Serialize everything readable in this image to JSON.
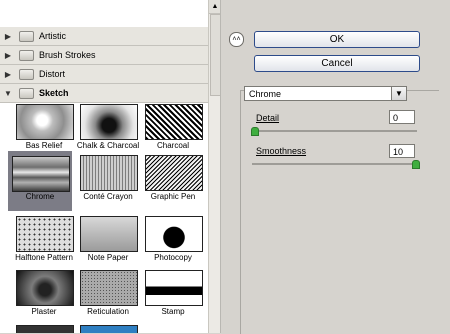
{
  "categories": [
    {
      "label": "Artistic",
      "open": false
    },
    {
      "label": "Brush Strokes",
      "open": false
    },
    {
      "label": "Distort",
      "open": false
    },
    {
      "label": "Sketch",
      "open": true
    }
  ],
  "icons": {
    "collapsed": "triangle-right",
    "expanded": "triangle-down",
    "folder": "folder-icon",
    "scroll_up": "arrow-up-icon",
    "collapse_btn": "double-chevron-up-icon"
  },
  "filters": [
    {
      "label": "Bas Relief",
      "selected": false
    },
    {
      "label": "Chalk & Charcoal",
      "selected": false
    },
    {
      "label": "Charcoal",
      "selected": false
    },
    {
      "label": "Chrome",
      "selected": true
    },
    {
      "label": "Conté Crayon",
      "selected": false
    },
    {
      "label": "Graphic Pen",
      "selected": false
    },
    {
      "label": "Halftone Pattern",
      "selected": false
    },
    {
      "label": "Note Paper",
      "selected": false
    },
    {
      "label": "Photocopy",
      "selected": false
    },
    {
      "label": "Plaster",
      "selected": false
    },
    {
      "label": "Reticulation",
      "selected": false
    },
    {
      "label": "Stamp",
      "selected": false
    }
  ],
  "buttons": {
    "ok": "OK",
    "cancel": "Cancel"
  },
  "filter_select": {
    "value": "Chrome"
  },
  "params": {
    "detail": {
      "label": "Detail",
      "value": "0",
      "fraction": 0.0
    },
    "smoothness": {
      "label": "Smoothness",
      "value": "10",
      "fraction": 1.0
    }
  }
}
